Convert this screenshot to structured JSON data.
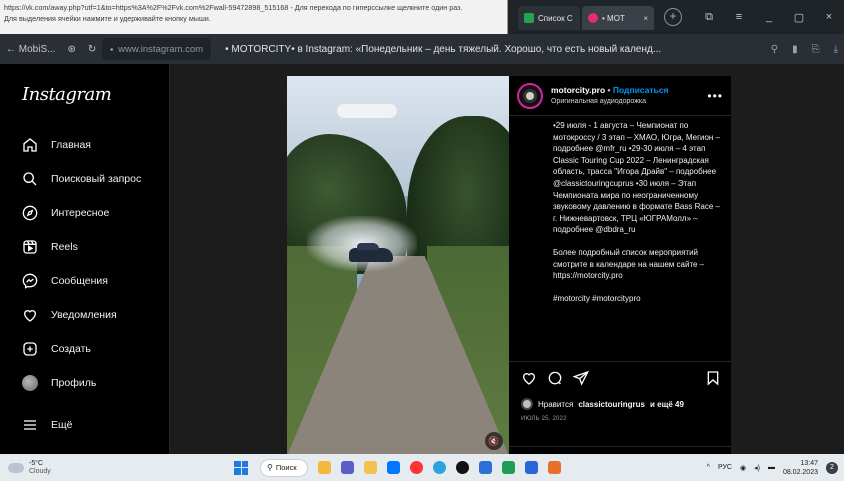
{
  "browser": {
    "status_tooltip": {
      "line1": "https://vk.com/away.php?utf=1&to=https%3A%2F%2Fvk.com%2Fwall-59472898_515168 - Для перехода по гиперссылке щелкните один раз.",
      "line2": "Для выделения ячейки нажмите и удерживайте кнопку мыши."
    },
    "tabs": [
      {
        "label": "Список С",
        "color": "#22a352"
      },
      {
        "label": "• МОТ",
        "color": "#e1306c",
        "close": "×"
      }
    ],
    "new_tab": "+",
    "window_controls": [
      "⧉",
      "≡",
      "_",
      "▢",
      "×"
    ],
    "back_label": "← MobiS...",
    "url": "www.instagram.com",
    "page_title": "• MOTORCITY• в Instagram: «Понедельник – день тяжелый. Хорошо, что есть новый календ...",
    "addr_icons": [
      "⚲",
      "▮",
      "⎘",
      "⤓"
    ]
  },
  "sidebar": {
    "logo": "Instagram",
    "items": [
      {
        "label": "Главная"
      },
      {
        "label": "Поисковый запрос"
      },
      {
        "label": "Интересное"
      },
      {
        "label": "Reels"
      },
      {
        "label": "Сообщения"
      },
      {
        "label": "Уведомления"
      },
      {
        "label": "Создать"
      },
      {
        "label": "Профиль"
      },
      {
        "label": "Ещё"
      }
    ]
  },
  "post": {
    "author": "motorcity.pro",
    "separator": " • ",
    "follow": "Подписаться",
    "audio": "Оригинальная аудиодорожка",
    "more": "•••",
    "caption": [
      "•29 июля - 1 августа – Чемпионат по мотокроссу / 3 этап – ХМАО, Югра, Мегион – подробнее @mfr_ru •29-30 июля – 4 этап Classic Touring Cup 2022 – Ленинградская область, трасса \"Игора Драйв\" – подробнее @classictouringcuprus •30 июля – Этап Чемпионата мира по неограниченному звуковому давлению в формате Bass Race – г. Нижневартовск, ТРЦ «ЮГРАМолл» – подробнее @dbdra_ru",
      "Более подробный список мероприятий смотрите в календаре на нашем сайте – https://motorcity.pro",
      "#motorcity #motorcitypro"
    ],
    "likes_prefix": "Нравится",
    "likes_user": "classictouringrus",
    "likes_suffix": "и ещё 49",
    "date": "ИЮЛЬ 25, 2022",
    "mute": "🔇"
  },
  "taskbar": {
    "weather_temp": "-5°C",
    "weather_cond": "Cloudy",
    "search": "Поиск",
    "apps": [
      {
        "name": "file-explorer",
        "color": "#f5b83d"
      },
      {
        "name": "teams",
        "color": "#5b5fc7"
      },
      {
        "name": "folder",
        "color": "#f2c14e"
      },
      {
        "name": "vk",
        "color": "#0077ff"
      },
      {
        "name": "yandex",
        "color": "#ff3333"
      },
      {
        "name": "telegram",
        "color": "#2aa3df"
      },
      {
        "name": "tiktok",
        "color": "#111111"
      },
      {
        "name": "defender",
        "color": "#2d6fd6"
      },
      {
        "name": "excel",
        "color": "#1f9d55"
      },
      {
        "name": "word",
        "color": "#2b66d9"
      },
      {
        "name": "photos",
        "color": "#e76f2a"
      }
    ],
    "tray_chevron": "^",
    "lang": "РУС",
    "time": "13:47",
    "date": "08.02.2023",
    "notif": "2"
  }
}
